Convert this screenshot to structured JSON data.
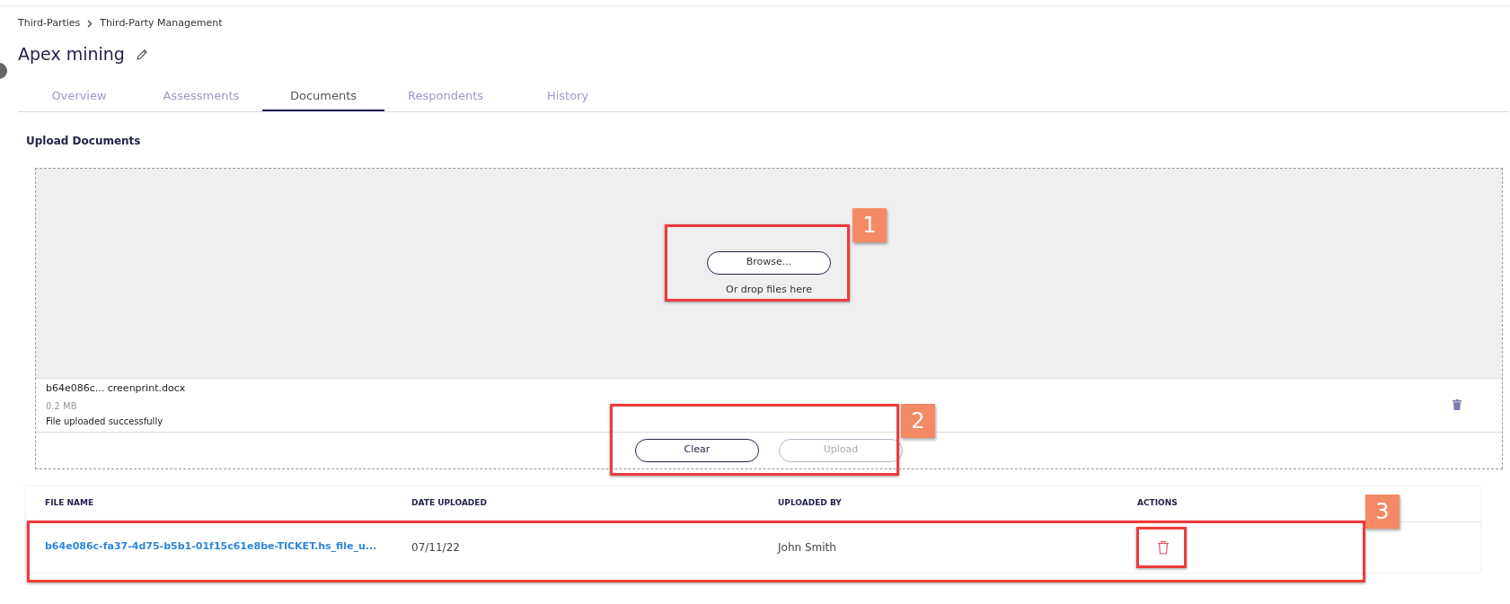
{
  "breadcrumb": [
    "Third-Parties",
    "Third-Party Management"
  ],
  "title": "Apex mining",
  "tabs": [
    {
      "label": "Overview",
      "selected": false
    },
    {
      "label": "Assessments",
      "selected": false
    },
    {
      "label": "Documents",
      "selected": true
    },
    {
      "label": "Respondents",
      "selected": false
    },
    {
      "label": "History",
      "selected": false
    }
  ],
  "upload": {
    "heading": "Upload Documents",
    "browse_button": "Browse...",
    "drop_hint": "Or drop files here",
    "file": {
      "name": "b64e086c... creenprint.docx",
      "size": "0.2 MB",
      "status": "File uploaded successfully"
    },
    "buttons": [
      {
        "label": "Clear",
        "disabled": false
      },
      {
        "label": "Upload",
        "disabled": true
      }
    ]
  },
  "table": {
    "columns": [
      "FILE NAME",
      "DATE UPLOADED",
      "UPLOADED BY",
      "ACTIONS"
    ],
    "rows": [
      {
        "file_name": "b64e086c-fa37-4d75-b5b1-01f15c61e8be-TICKET.hs_file_u...",
        "date_uploaded": "07/11/22",
        "uploaded_by": "John Smith"
      }
    ]
  },
  "callouts": [
    "1",
    "2",
    "3"
  ]
}
